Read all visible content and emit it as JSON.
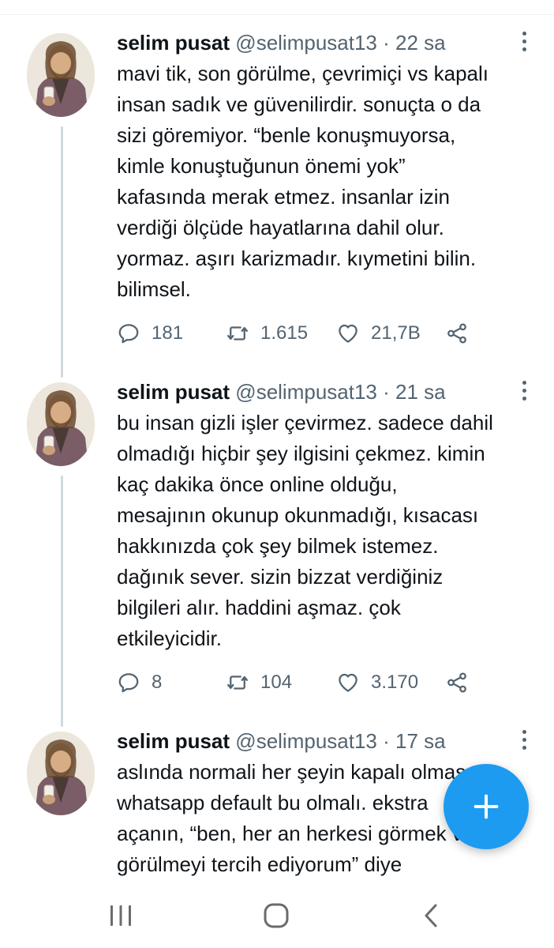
{
  "tweets": [
    {
      "name": "selim pusat",
      "handle": "@selimpusat13",
      "separator": "·",
      "time": "22 sa",
      "text": "mavi tik, son görülme, çevrimiçi vs kapalı\ninsan sadık ve güvenilirdir. sonuçta o da\nsizi göremiyor. “benle konuşmuyorsa,\nkimle konuştuğunun önemi yok”\nkafasında merak etmez. insanlar izin\nverdiği ölçüde hayatlarına dahil olur.\nyormaz. aşırı karizmadır. kıymetini bilin.\nbilimsel.",
      "replies": "181",
      "retweets": "1.615",
      "likes": "21,7B"
    },
    {
      "name": "selim pusat",
      "handle": "@selimpusat13",
      "separator": "·",
      "time": "21 sa",
      "text": "bu insan gizli işler çevirmez. sadece dahil\nolmadığı hiçbir şey ilgisini çekmez. kimin\nkaç dakika önce online olduğu,\nmesajının okunup okunmadığı, kısacası\nhakkınızda çok şey bilmek istemez.\ndağınık sever. sizin bizzat verdiğiniz\nbilgileri alır. haddini aşmaz. çok\netkileyicidir.",
      "replies": "8",
      "retweets": "104",
      "likes": "3.170"
    },
    {
      "name": "selim pusat",
      "handle": "@selimpusat13",
      "separator": "·",
      "time": "17 sa",
      "text": "aslında normali her şeyin kapalı olması\nwhatsapp default bu olmalı. ekstra\naçanın, “ben, her an herkesi görmek ve\ngörülmeyi tercih ediyorum” diye"
    }
  ],
  "icons": {
    "reply": "reply-icon",
    "retweet": "retweet-icon",
    "like": "heart-icon",
    "share": "share-icon",
    "more": "more-vertical-icon",
    "compose": "plus-icon",
    "recents": "recents-icon",
    "home": "home-icon",
    "back": "back-icon"
  },
  "colors": {
    "accent": "#1d9bf0",
    "secondary_text": "#536471",
    "thread_line": "#cfd9de"
  }
}
